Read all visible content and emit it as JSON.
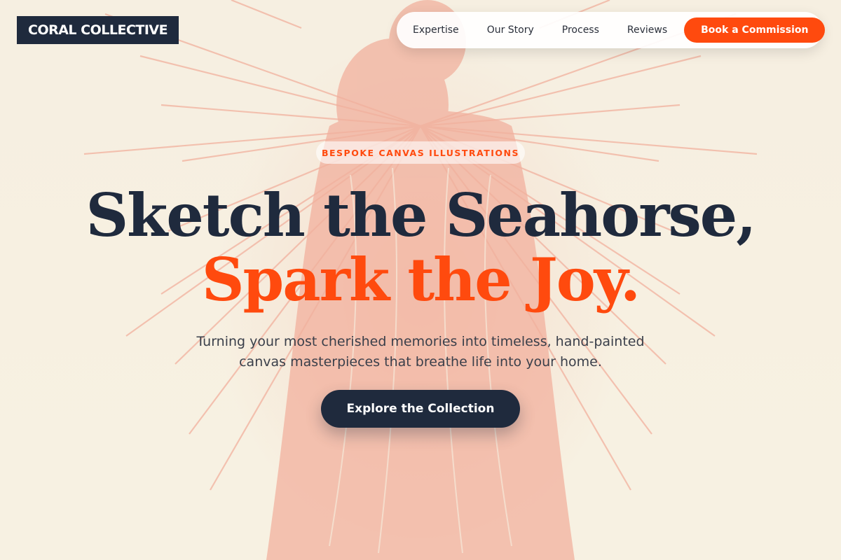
{
  "brand": {
    "name": "CORAL COLLECTIVE"
  },
  "nav": {
    "items": [
      "Expertise",
      "Our Story",
      "Process",
      "Reviews"
    ],
    "cta": "Book a Commission"
  },
  "hero": {
    "eyebrow": "BESPOKE CANVAS ILLUSTRATIONS",
    "headline_line1": "Sketch the Seahorse,",
    "headline_line2": "Spark the Joy.",
    "subtitle": "Turning your most cherished memories into timeless, hand-painted canvas masterpieces that breathe life into your home.",
    "button": "Explore the Collection"
  },
  "colors": {
    "navy": "#1f2a3d",
    "accent": "#ff4a0e",
    "background": "#f7f1e1",
    "illustration": "#f09682"
  },
  "icons": {
    "background_art": "winged-figure-illustration"
  }
}
